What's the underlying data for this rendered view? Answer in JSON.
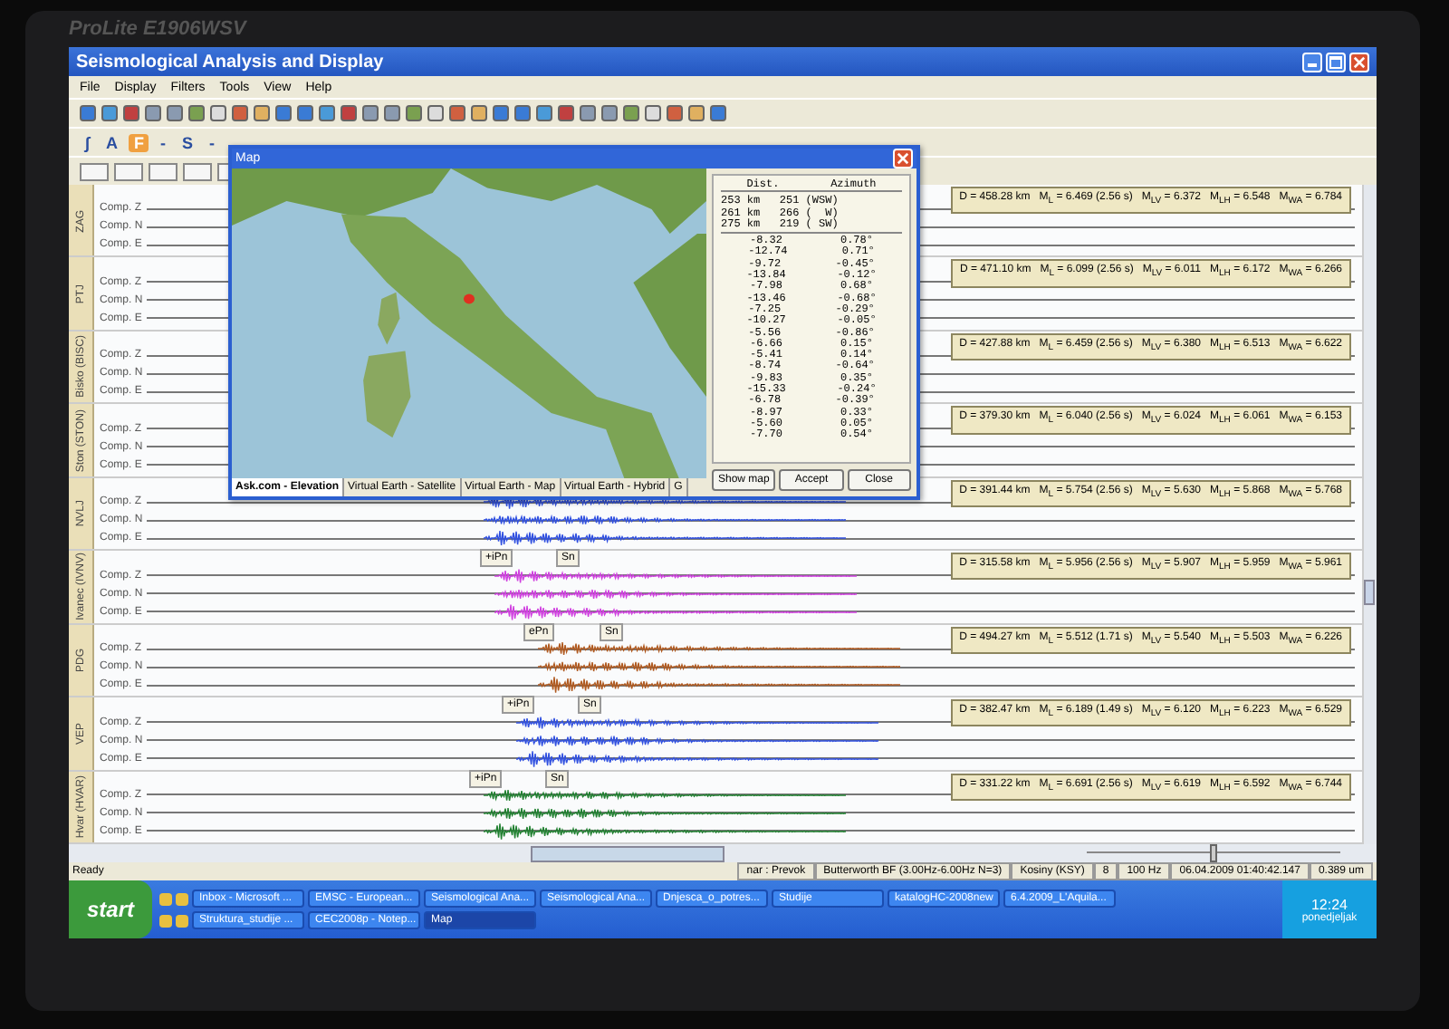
{
  "monitor": {
    "brand": "ProLite E1906WSV"
  },
  "window": {
    "title": "Seismological Analysis and Display"
  },
  "menu": [
    "File",
    "Display",
    "Filters",
    "Tools",
    "View",
    "Help"
  ],
  "toolbar2": [
    {
      "label": "∫",
      "selected": false
    },
    {
      "label": "A",
      "selected": false
    },
    {
      "label": "F",
      "selected": true
    },
    {
      "label": "-",
      "selected": false
    },
    {
      "label": "S",
      "selected": false
    },
    {
      "label": "-",
      "selected": false
    }
  ],
  "stations": [
    {
      "name": "ZAG",
      "components": [
        "Comp. Z",
        "Comp. N",
        "Comp. E"
      ],
      "info": "D = 458.28 km   M$_{L}$ = 6.469 (2.56 s)   M$_{LV}$ = 6.372   M$_{LH}$ = 6.548   M$_{WA}$ = 6.784"
    },
    {
      "name": "PTJ",
      "components": [
        "Comp. Z",
        "Comp. N",
        "Comp. E"
      ],
      "info": "D = 471.10 km   M$_{L}$ = 6.099 (2.56 s)   M$_{LV}$ = 6.011   M$_{LH}$ = 6.172   M$_{WA}$ = 6.266"
    },
    {
      "name": "Bisko (BISC)",
      "components": [
        "Comp. Z",
        "Comp. N",
        "Comp. E"
      ],
      "info": "D = 427.88 km   M$_{L}$ = 6.459 (2.56 s)   M$_{LV}$ = 6.380   M$_{LH}$ = 6.513   M$_{WA}$ = 6.622"
    },
    {
      "name": "Ston (STON)",
      "components": [
        "Comp. Z",
        "Comp. N",
        "Comp. E"
      ],
      "info": "D = 379.30 km   M$_{L}$ = 6.040 (2.56 s)   M$_{LV}$ = 6.024   M$_{LH}$ = 6.061   M$_{WA}$ = 6.153"
    },
    {
      "name": "NVLJ",
      "components": [
        "Comp. Z",
        "Comp. N",
        "Comp. E"
      ],
      "info": "D = 391.44 km   M$_{L}$ = 5.754 (2.56 s)   M$_{LV}$ = 5.630   M$_{LH}$ = 5.868   M$_{WA}$ = 5.768",
      "color": "#3050e0"
    },
    {
      "name": "Ivanec (IVNV)",
      "components": [
        "Comp. Z",
        "Comp. N",
        "Comp. E"
      ],
      "info": "D = 315.58 km   M$_{L}$ = 5.956 (2.56 s)   M$_{LV}$ = 5.907   M$_{LH}$ = 5.959   M$_{WA}$ = 5.961",
      "picks": [
        "+iPn",
        "Sn"
      ],
      "color": "#d040e0"
    },
    {
      "name": "PDG",
      "components": [
        "Comp. Z",
        "Comp. N",
        "Comp. E"
      ],
      "info": "D = 494.27 km   M$_{L}$ = 5.512 (1.71 s)   M$_{LV}$ = 5.540   M$_{LH}$ = 5.503   M$_{WA}$ = 6.226",
      "picks": [
        "ePn",
        "Sn"
      ],
      "color": "#b05a20"
    },
    {
      "name": "VEP",
      "components": [
        "Comp. Z",
        "Comp. N",
        "Comp. E"
      ],
      "info": "D = 382.47 km   M$_{L}$ = 6.189 (1.49 s)   M$_{LV}$ = 6.120   M$_{LH}$ = 6.223   M$_{WA}$ = 6.529",
      "picks": [
        "+iPn",
        "Sn"
      ],
      "color": "#3050e0"
    },
    {
      "name": "Hvar (HVAR)",
      "components": [
        "Comp. Z",
        "Comp. N",
        "Comp. E"
      ],
      "info": "D = 331.22 km   M$_{L}$ = 6.691 (2.56 s)   M$_{LV}$ = 6.619   M$_{LH}$ = 6.592   M$_{WA}$ = 6.744",
      "picks": [
        "+iPn",
        "Sn"
      ],
      "color": "#208030"
    }
  ],
  "map_dialog": {
    "title": "Map",
    "tabs": [
      {
        "label": "Ask.com - Elevation",
        "selected": true
      },
      {
        "label": "Virtual Earth - Satellite",
        "selected": false
      },
      {
        "label": "Virtual Earth - Map",
        "selected": false
      },
      {
        "label": "Virtual Earth - Hybrid",
        "selected": false
      },
      {
        "label": "G",
        "selected": false
      }
    ],
    "headers": [
      "Dist.",
      "Azimuth"
    ],
    "distances": [
      "253 km   251 (WSW)",
      "261 km   266 (  W)",
      "275 km   219 ( SW)"
    ],
    "values": [
      [
        "-8.32",
        "0.78°"
      ],
      [
        "-12.74",
        "0.71°"
      ],
      [
        "-9.72",
        "-0.45°"
      ],
      [
        "-13.84",
        "-0.12°"
      ],
      [
        "-7.98",
        "0.68°"
      ],
      [
        "-13.46",
        "-0.68°"
      ],
      [
        "-7.25",
        "-0.29°"
      ],
      [
        "-10.27",
        "-0.05°"
      ],
      [
        "-5.56",
        "-0.86°"
      ],
      [
        "-6.66",
        "0.15°"
      ],
      [
        "-5.41",
        "0.14°"
      ],
      [
        "-8.74",
        "-0.64°"
      ],
      [
        "-9.83",
        "0.35°"
      ],
      [
        "-15.33",
        "-0.24°"
      ],
      [
        "-6.78",
        "-0.39°"
      ],
      [
        "-8.97",
        "0.33°"
      ],
      [
        "-5.60",
        "0.05°"
      ],
      [
        "-7.70",
        "0.54°"
      ]
    ],
    "buttons": [
      "Show map",
      "Accept",
      "Close"
    ]
  },
  "zoom_slider": {
    "level": 0.5
  },
  "status": "Ready",
  "info_bar": [
    "nar : Prevok",
    "Butterworth BF (3.00Hz-6.00Hz N=3)",
    "Kosiny (KSY)",
    "8",
    "100 Hz",
    "06.04.2009 01:40:42.147",
    "0.389 um"
  ],
  "taskbar": {
    "start": "start",
    "row1": [
      {
        "label": "Inbox - Microsoft ...",
        "selected": false
      },
      {
        "label": "EMSC - European...",
        "selected": false
      },
      {
        "label": "Seismological Ana...",
        "selected": false
      },
      {
        "label": "Seismological Ana...",
        "selected": false
      },
      {
        "label": "Dnjesca_o_potres...",
        "selected": false
      },
      {
        "label": "Studije",
        "selected": false
      },
      {
        "label": "katalogHC-2008new",
        "selected": false
      },
      {
        "label": "6.4.2009_L'Aquila...",
        "selected": false
      }
    ],
    "row2": [
      {
        "label": "Struktura_studije ...",
        "selected": false
      },
      {
        "label": "CEC2008p - Notep...",
        "selected": false
      },
      {
        "label": "Map",
        "selected": true
      }
    ],
    "clock": "12:24",
    "day": "ponedjeljak"
  }
}
